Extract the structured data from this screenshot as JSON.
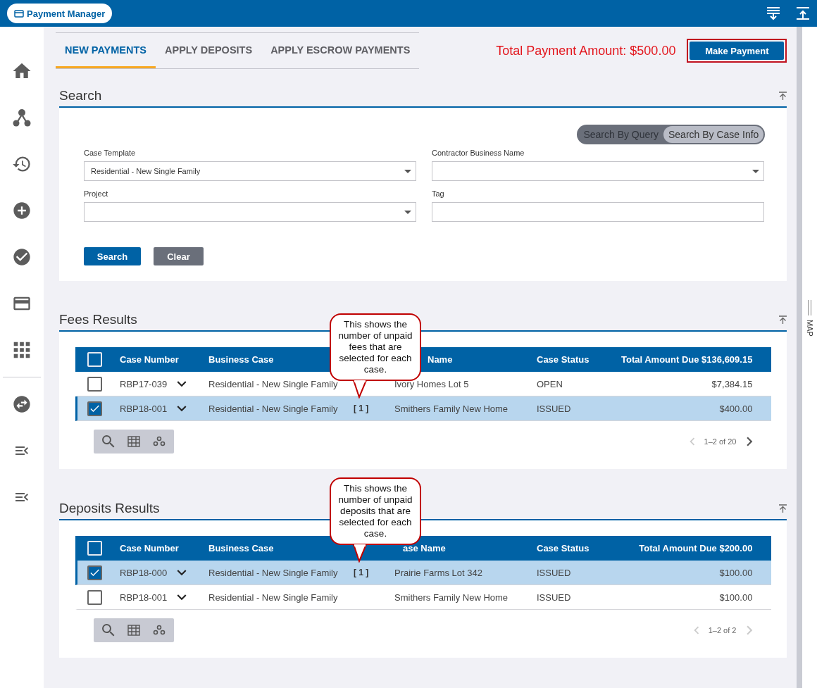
{
  "app_badge": {
    "label": "Payment Manager"
  },
  "sidebar": {
    "items": [
      {
        "kind": "home"
      },
      {
        "kind": "network"
      },
      {
        "kind": "history"
      },
      {
        "kind": "add"
      },
      {
        "kind": "check"
      },
      {
        "kind": "card"
      },
      {
        "kind": "apps"
      },
      {
        "kind": "divider"
      },
      {
        "kind": "swap"
      },
      {
        "kind": "menu"
      },
      {
        "kind": "menu"
      }
    ]
  },
  "tabs": [
    {
      "label": "NEW PAYMENTS",
      "selected": true
    },
    {
      "label": "APPLY DEPOSITS",
      "selected": false
    },
    {
      "label": "APPLY ESCROW PAYMENTS",
      "selected": false
    }
  ],
  "total_payment": "Total Payment Amount: $500.00",
  "make_payment": "Make Payment",
  "search": {
    "title": "Search",
    "modes": [
      {
        "label": "Search By Query",
        "selected": false
      },
      {
        "label": "Search By Case Info",
        "selected": true
      }
    ],
    "fields": [
      {
        "label": "Case Template",
        "value": "Residential - New Single Family",
        "kind": "select"
      },
      {
        "label": "Contractor Business Name",
        "kind": "select"
      },
      {
        "label": "Project",
        "kind": "select"
      },
      {
        "label": "Tag",
        "kind": "text"
      }
    ],
    "buttons": [
      {
        "label": "Search",
        "kind": "primary"
      },
      {
        "label": "Clear",
        "kind": "secondary"
      }
    ]
  },
  "results": [
    {
      "title": "Fees Results",
      "all_checked": false,
      "columns": [
        "Case Number",
        "Business Case",
        "Name",
        "Case Status",
        "Total Amount Due $136,609.15"
      ],
      "rows": [
        {
          "checked": false,
          "case_number": "RBP17-039",
          "business_case": "Residential - New Single Family",
          "count": "",
          "case_name": "Ivory Homes Lot 5",
          "status": "OPEN",
          "amount": "$7,384.15"
        },
        {
          "checked": true,
          "case_number": "RBP18-001",
          "business_case": "Residential - New Single Family",
          "count": "[ 1 ]",
          "case_name": "Smithers Family New Home",
          "status": "ISSUED",
          "amount": "$400.00"
        }
      ],
      "pager": "1–2 of 20",
      "next_enabled": true,
      "callout": "This shows the number of unpaid fees that are selected for each case."
    },
    {
      "title": "Deposits Results",
      "all_checked": false,
      "columns": [
        "Case Number",
        "Business Case",
        "ase Name",
        "Case Status",
        "Total Amount Due $200.00"
      ],
      "rows": [
        {
          "checked": true,
          "case_number": "RBP18-000",
          "business_case": "Residential - New Single Family",
          "count": "[ 1 ]",
          "case_name": "Prairie Farms Lot 342",
          "status": "ISSUED",
          "amount": "$100.00"
        },
        {
          "checked": false,
          "case_number": "RBP18-001",
          "business_case": "Residential - New Single Family",
          "count": "",
          "case_name": "Smithers Family New Home",
          "status": "ISSUED",
          "amount": "$100.00"
        }
      ],
      "pager": "1–2 of 2",
      "next_enabled": false,
      "callout": "This shows the number of unpaid deposits that are selected for each case."
    }
  ],
  "map_panel": {
    "label": "MAP"
  }
}
